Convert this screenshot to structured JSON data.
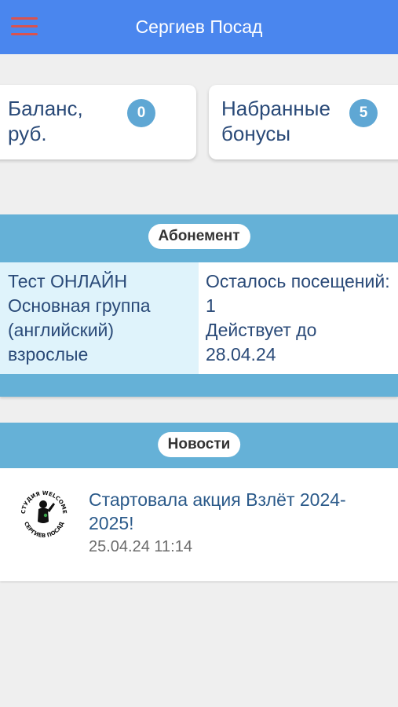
{
  "header": {
    "title": "Сергиев Посад",
    "menu_icon": "hamburger-menu-icon",
    "bar_color": "#4a86ee",
    "menu_color": "#d9534f"
  },
  "cards": {
    "balance": {
      "label": "Баланс, руб.",
      "value": "0"
    },
    "bonus": {
      "label": "Набранные бонусы",
      "value": "5"
    }
  },
  "subscription": {
    "heading": "Абонемент",
    "name": "Тест ОНЛАЙН Основная группа (английский) взрослые",
    "visits": "Осталось посещений: 1",
    "valid_until": "Действует до 28.04.24",
    "accent_color": "#65b1d7"
  },
  "news": {
    "heading": "Новости",
    "items": [
      {
        "title": "Стартовала акция Взлёт 2024-2025!",
        "date": "25.04.24 11:14",
        "logo_text_top": "СТУДИЯ WELCOME",
        "logo_text_bottom": "СЕРГИЕВ ПОСАД"
      }
    ]
  }
}
